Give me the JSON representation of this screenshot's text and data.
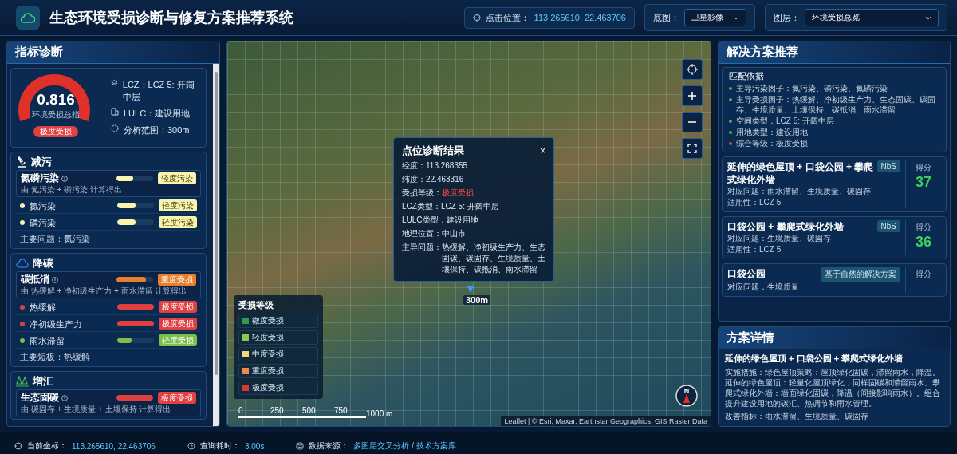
{
  "header": {
    "title": "生态环境受损诊断与修复方案推荐系统",
    "point": {
      "label": "点击位置：",
      "value": "113.265610, 22.463706"
    },
    "basemap": {
      "label": "底图：",
      "value": "卫星影像"
    },
    "layer": {
      "label": "图层：",
      "value": "环境受损总览"
    }
  },
  "left": {
    "title": "指标诊断",
    "gauge": {
      "value": "0.816",
      "caption": "环境受损总指",
      "badge": "极度受损"
    },
    "info": [
      {
        "kind": "lcz",
        "text": "LCZ：LCZ 5: 开阔中层"
      },
      {
        "kind": "lulc",
        "text": "LULC：建设用地"
      },
      {
        "kind": "range",
        "text": "分析范围：300m"
      }
    ],
    "sections": [
      {
        "kind": "pollution",
        "title": "减污",
        "summary": {
          "name": "氮磷污染",
          "note": "由 氮污染 + 磷污染 计算得出",
          "level": 0.45,
          "color": "#f8f5b0",
          "tag": "轻度污染"
        },
        "rows": [
          {
            "name": "氮污染",
            "level": 0.5,
            "color": "#f8f5b0",
            "tag": "轻度污染"
          },
          {
            "name": "磷污染",
            "level": 0.5,
            "color": "#f8f5b0",
            "tag": "轻度污染"
          }
        ],
        "footer": "主要问题：氮污染"
      },
      {
        "kind": "carbon",
        "title": "降碳",
        "summary": {
          "name": "碳抵消",
          "note": "由 热缓解 + 净初级生产力 + 雨水滞留 计算得出",
          "level": 0.8,
          "color": "#e8802a",
          "tag": "重度受损"
        },
        "rows": [
          {
            "name": "热缓解",
            "level": 1,
            "color": "#e04040",
            "tag": "极度受损"
          },
          {
            "name": "净初级生产力",
            "level": 1,
            "color": "#e04040",
            "tag": "极度受损"
          },
          {
            "name": "雨水滞留",
            "level": 0.4,
            "color": "#7cc04a",
            "tag": "轻度受损"
          }
        ],
        "footer": "主要短板：热缓解"
      },
      {
        "kind": "sink",
        "title": "增汇",
        "summary": {
          "name": "生态固碳",
          "note": "由 碳固存 + 生境质量 + 土壤保持 计算得出",
          "level": 1,
          "color": "#e04040",
          "tag": "极度受损"
        }
      }
    ]
  },
  "map": {
    "marker_label": "300m",
    "popup": {
      "title": "点位诊断结果",
      "close": "×",
      "lines": [
        {
          "label": "经度：",
          "value": "113.268355",
          "alert": false
        },
        {
          "label": "纬度：",
          "value": "22.463316",
          "alert": false
        },
        {
          "label": "受损等级：",
          "value": "极度受损",
          "alert": true
        },
        {
          "label": "LCZ类型：",
          "value": "LCZ 5: 开阔中层",
          "alert": false
        },
        {
          "label": "LULC类型：",
          "value": "建设用地",
          "alert": false
        },
        {
          "label": "地理位置：",
          "value": "中山市",
          "alert": false
        },
        {
          "label": "主导问题：",
          "value": "热缓解、净初级生产力、生态固碳、碳固存、生境质量、土壤保持、碳抵消、雨水滞留",
          "alert": false
        }
      ]
    },
    "legend": {
      "title": "受损等级",
      "items": [
        {
          "label": "微度受损",
          "color": "#2e9a4a"
        },
        {
          "label": "轻度受损",
          "color": "#8cc850"
        },
        {
          "label": "中度受损",
          "color": "#f5d67a"
        },
        {
          "label": "重度受损",
          "color": "#ee8a50"
        },
        {
          "label": "极度受损",
          "color": "#d83a30"
        }
      ]
    },
    "scale": [
      "0",
      "250",
      "500",
      "750",
      "1000 m"
    ],
    "compass": "N",
    "attribution": "Leaflet | © Esri, Maxar, Earthstar Geographics, GIS Raster Data"
  },
  "right": {
    "title": "解决方案推荐",
    "basis": {
      "title": "匹配依据",
      "items": [
        {
          "text": "主导污染因子：氮污染、磷污染、氮磷污染",
          "color": "#4caf50"
        },
        {
          "text": "主导受损因子：热缓解、净初级生产力、生态固碳、碳固存、生境质量、土壤保持、碳抵消、雨水滞留",
          "color": "#4caf50"
        },
        {
          "text": "空间类型：LCZ 5: 开阔中层",
          "color": "#4caf50"
        },
        {
          "text": "用地类型：建设用地",
          "color": "#4caf50"
        },
        {
          "text": "综合等级：极度受损",
          "color": "#e04040"
        }
      ]
    },
    "solutions": [
      {
        "title": "延伸的绿色屋顶 + 口袋公园 + 攀爬式绿化外墙",
        "tag": "NbS",
        "issues": "对应问题：雨水滞留、生境质量、碳固存",
        "fit": "适用性：LCZ 5",
        "score_label": "得分",
        "score": "37"
      },
      {
        "title": "口袋公园 + 攀爬式绿化外墙",
        "tag": "NbS",
        "issues": "对应问题：生境质量、碳固存",
        "fit": "适用性：LCZ 5",
        "score_label": "得分",
        "score": "36"
      },
      {
        "title": "口袋公园",
        "tag": "基于自然的解决方案",
        "issues": "对应问题：生境质量",
        "score_label": "得分"
      }
    ],
    "detail": {
      "title": "方案详情",
      "name": "延伸的绿色屋顶 + 口袋公园 + 攀爬式绿化外墙",
      "body": "实施措施：绿色屋顶策略：屋顶绿化固碳，滞留雨水，降温。延伸的绿色屋顶：轻量化屋顶绿化，同样固碳和滞留雨水。攀爬式绿化外墙：墙面绿化固碳，降温（间接影响雨水）。组合提升建设用地的碳汇、热调节和雨水管理。",
      "improve": "改善指标：雨水滞留、生境质量、碳固存"
    }
  },
  "status": [
    {
      "kind": "coord",
      "label": "当前坐标：",
      "value": "113.265610, 22.463706"
    },
    {
      "kind": "time",
      "label": "查询耗时：",
      "value": "3.00s"
    },
    {
      "kind": "source",
      "label": "数据来源：",
      "value": "多图层交叉分析 / 技术方案库"
    }
  ]
}
